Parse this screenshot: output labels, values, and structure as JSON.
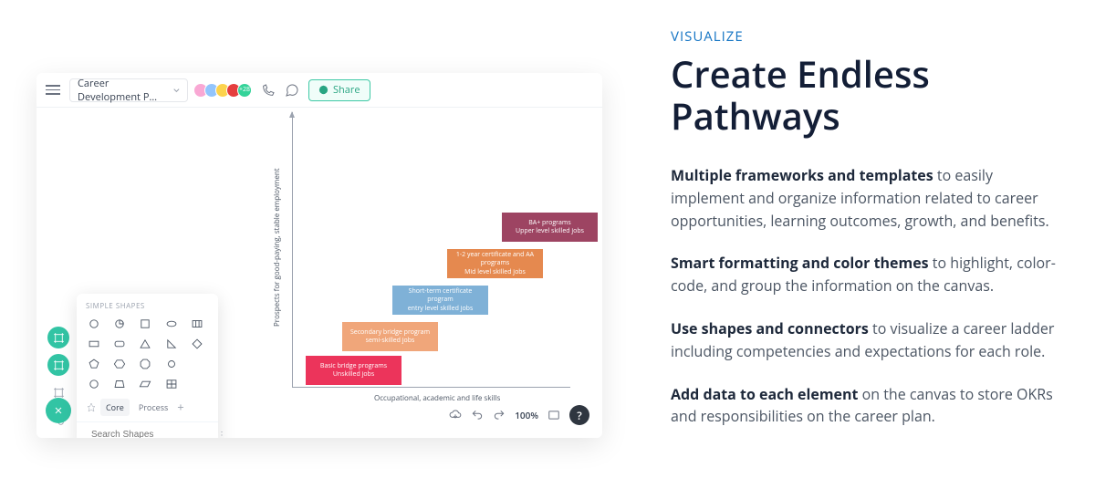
{
  "copy": {
    "eyebrow": "VISUALIZE",
    "heading": "Create Endless Pathways",
    "p1_strong": "Multiple frameworks and templates",
    "p1_rest": " to easily implement and organize information related to career opportunities, learning outcomes, growth, and benefits.",
    "p2_strong": "Smart formatting and color themes",
    "p2_rest": " to highlight, color-code, and group the information on the canvas.",
    "p3_strong": "Use shapes and connectors",
    "p3_rest": " to visualize a career ladder including competencies and expectations for each role.",
    "p4_strong": "Add data to each element",
    "p4_rest": " on the canvas to store OKRs and responsibilities on the career plan."
  },
  "app": {
    "doc_name": "Career Development P…",
    "avatar_extra": "+28",
    "share_label": "Share",
    "zoom": "100%",
    "help": "?",
    "y_axis_label": "Prospects   for  good-paying,   stable   employment",
    "x_axis_label": "Occupational,    academic   and   life  skills"
  },
  "steps": {
    "s1a": "Basic  bridge  programs",
    "s1b": "Unskilled  jobs",
    "s2a": "Secondary  bridge  program",
    "s2b": "semi-skilled  jobs",
    "s3a": "Short-term  certificate  program",
    "s3b": "entry  level  skilled  jobs",
    "s4a": "1-2  year  certificate   and  AA programs",
    "s4b": "Mid  level  skilled  jobs",
    "s5a": "BA+  programs",
    "s5b": "Upper  level  skilled  jobs"
  },
  "panel": {
    "title": "SIMPLE SHAPES",
    "tab_core": "Core",
    "tab_process": "Process",
    "search_placeholder": "Search Shapes"
  }
}
